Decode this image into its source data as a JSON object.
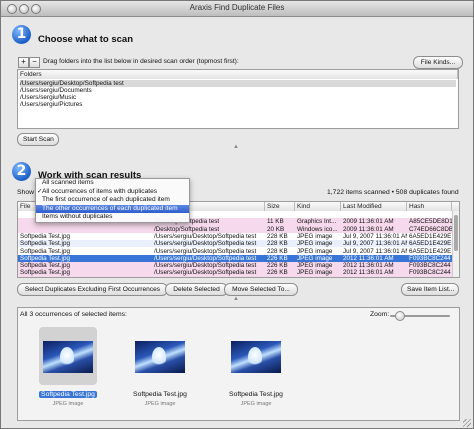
{
  "window": {
    "title": "Araxis Find Duplicate Files"
  },
  "step1": {
    "number": "1",
    "heading": "Choose what to scan",
    "add_label": "+",
    "remove_label": "−",
    "instructions": "Drag folders into the list below in desired scan order (topmost first):",
    "file_kinds_label": "File Kinds...",
    "folders_header": "Folders",
    "folders": [
      "/Users/sergiu/Desktop/Softpedia test",
      "/Users/sergiu/Documents",
      "/Users/sergiu/Music",
      "/Users/sergiu/Pictures"
    ],
    "start_scan_label": "Start Scan"
  },
  "step2": {
    "number": "2",
    "heading": "Work with scan results",
    "show_label": "Show",
    "status": "1,722 items scanned • 508 duplicates found",
    "menu_options": [
      {
        "label": "All scanned items",
        "checked": false,
        "highlighted": false
      },
      {
        "label": "All occurrences of items with duplicates",
        "checked": true,
        "highlighted": false
      },
      {
        "label": "The first occurrence of each duplicated item",
        "checked": false,
        "highlighted": false
      },
      {
        "label": "The other occurrences of each duplicated item",
        "checked": false,
        "highlighted": true
      },
      {
        "label": "Items without duplicates",
        "checked": false,
        "highlighted": false
      }
    ],
    "columns": [
      "File",
      "",
      "Size",
      "Kind",
      "Last Modified",
      "Hash"
    ],
    "rows": [
      {
        "name": "",
        "path": "",
        "size": "",
        "kind": "",
        "modified": "",
        "hash": "",
        "bg": "#ffffff"
      },
      {
        "name": "",
        "path": "/Desktop/Softpedia test",
        "size": "11 KB",
        "kind": "Graphics Int...",
        "modified": "2009 11:36:01 AM",
        "hash": "A85CE5DE8D1",
        "bg": "#f6d9ec"
      },
      {
        "name": "",
        "path": "/Desktop/Softpedia test",
        "size": "20 KB",
        "kind": "Windows ico...",
        "modified": "2009 11:36:01 AM",
        "hash": "C74ED66C8DB",
        "bg": "#f6d9ec"
      },
      {
        "name": "Softpedia Test.jpg",
        "path": "/Users/sergiu/Desktop/Softpedia test",
        "size": "228 KB",
        "kind": "JPEG image",
        "modified": "Jul 9, 2007 11:36:01 AM",
        "hash": "6A5ED1E429E",
        "bg": "#ffffff"
      },
      {
        "name": "Softpedia Test.jpg",
        "path": "/Users/sergiu/Desktop/Softpedia test",
        "size": "228 KB",
        "kind": "JPEG image",
        "modified": "Jul 9, 2007 11:36:01 AM",
        "hash": "6A5ED1E429E",
        "bg": "#eaf0fb"
      },
      {
        "name": "Softpedia Test.jpg",
        "path": "/Users/sergiu/Desktop/Softpedia test",
        "size": "228 KB",
        "kind": "JPEG image",
        "modified": "Jul 9, 2007 11:36:01 AM",
        "hash": "6A5ED1E429E",
        "bg": "#ffffff"
      },
      {
        "name": "Softpedia Test.jpg",
        "path": "/Users/sergiu/Desktop/Softpedia test",
        "size": "226 KB",
        "kind": "JPEG image",
        "modified": "2012 11:36:01 AM",
        "hash": "F093BC8C244",
        "bg": "#3875d7"
      },
      {
        "name": "Softpedia Test.jpg",
        "path": "/Users/sergiu/Desktop/Softpedia test",
        "size": "226 KB",
        "kind": "JPEG image",
        "modified": "2012 11:36:01 AM",
        "hash": "F093BC8C244",
        "bg": "#f6d9ec"
      },
      {
        "name": "Softpedia Test.jpg",
        "path": "/Users/sergiu/Desktop/Softpedia test",
        "size": "226 KB",
        "kind": "JPEG image",
        "modified": "2012 11:36:01 AM",
        "hash": "F093BC8C244",
        "bg": "#f6d9ec"
      }
    ],
    "buttons": {
      "select_dupes": "Select Duplicates Excluding First Occurrences",
      "delete": "Delete Selected",
      "move": "Move Selected To...",
      "save": "Save Item List..."
    }
  },
  "preview": {
    "header": "All 3 occurrences of selected items:",
    "zoom_label": "Zoom:",
    "zoom_level": 0.15,
    "items": [
      {
        "name": "Softpedia Test.jpg",
        "kind": "JPEG image",
        "selected": true
      },
      {
        "name": "Softpedia Test.jpg",
        "kind": "JPEG image",
        "selected": false
      },
      {
        "name": "Softpedia Test.jpg",
        "kind": "JPEG image",
        "selected": false
      }
    ]
  },
  "colors": {
    "selection": "#3875d7",
    "duplicate_pink": "#f6d9ec",
    "accent": "#1d5fc7"
  }
}
